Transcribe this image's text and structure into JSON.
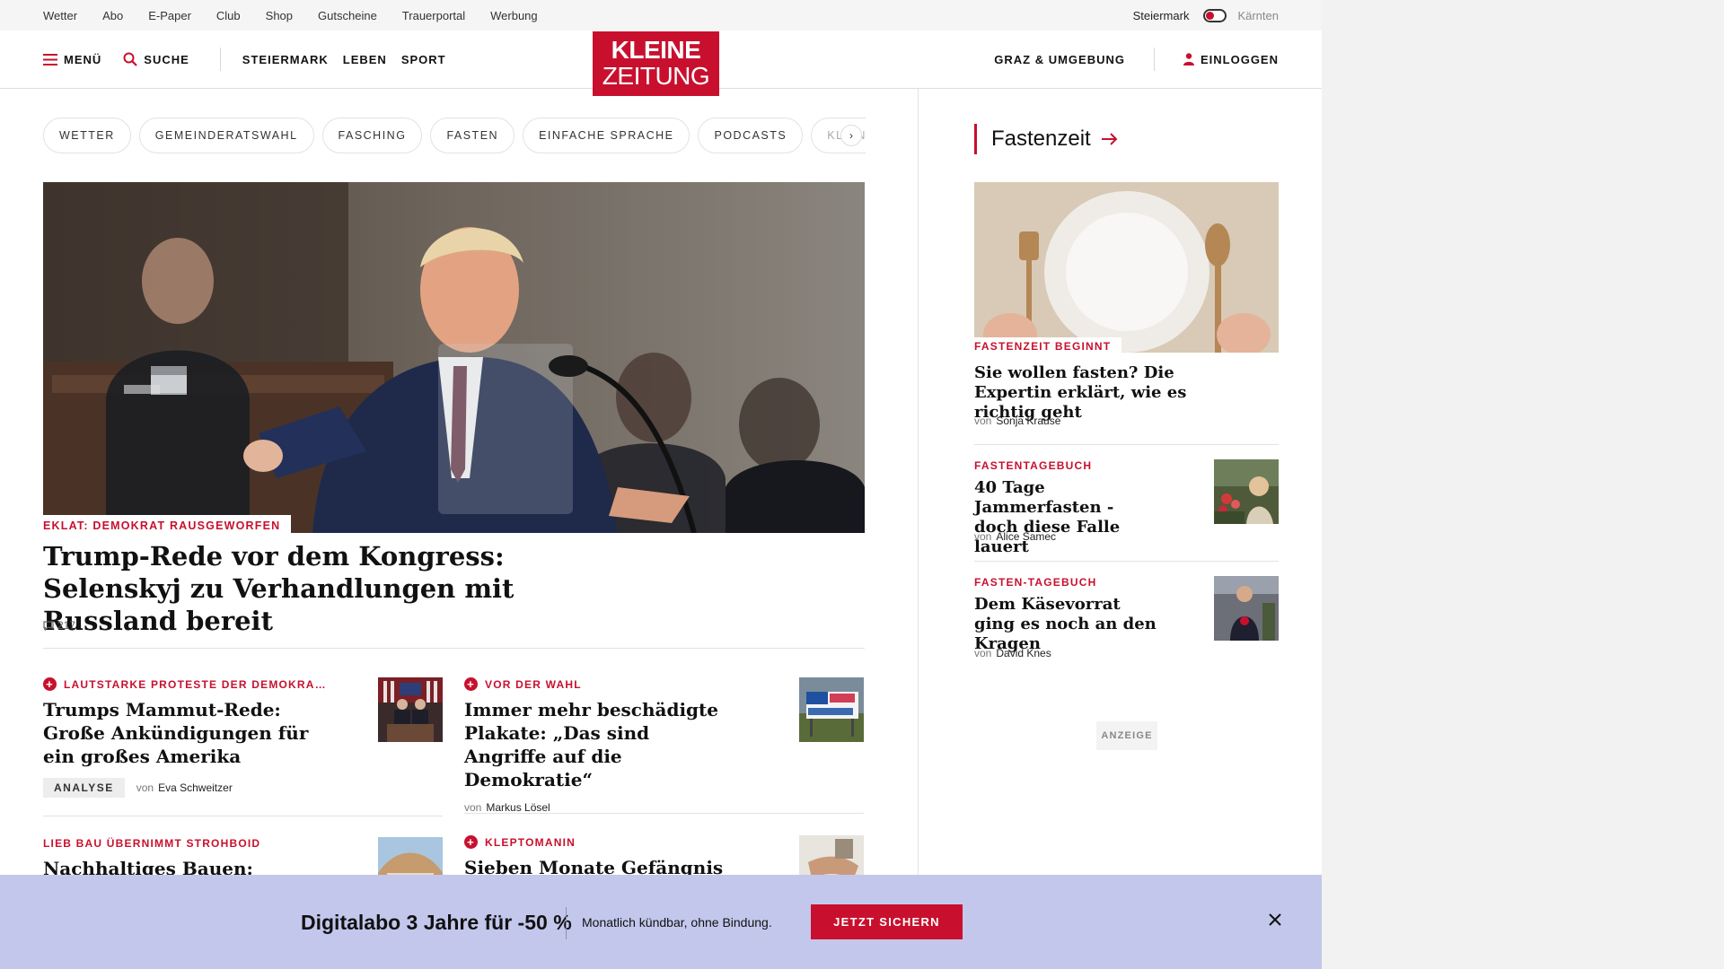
{
  "utility_bar": {
    "links": [
      "Wetter",
      "Abo",
      "E-Paper",
      "Club",
      "Shop",
      "Gutscheine",
      "Trauerportal",
      "Werbung"
    ],
    "region_active": "Steiermark",
    "region_inactive": "Kärnten"
  },
  "header": {
    "menu_label": "MENÜ",
    "search_label": "SUCHE",
    "nav": [
      "STEIERMARK",
      "LEBEN",
      "SPORT"
    ],
    "logo_line1": "KLEINE",
    "logo_line2": "ZEITUNG",
    "local_label": "GRAZ & UMGEBUNG",
    "login_label": "EINLOGGEN"
  },
  "topics": [
    "WETTER",
    "GEMEINDERATSWAHL",
    "FASCHING",
    "FASTEN",
    "EINFACHE SPRACHE",
    "PODCASTS",
    "KLEINE KIN"
  ],
  "hero": {
    "kicker": "EKLAT: DEMOKRAT RAUSGEWORFEN",
    "title": "Trump-Rede vor dem Kongress: Selenskyj zu Verhandlungen mit Russland bereit",
    "comments": "217"
  },
  "articles": [
    {
      "kicker": "LAUTSTARKE PROTESTE DER DEMOKRA…",
      "title": "Trumps Mammut-Rede: Große Ankündigungen für ein großes Amerika",
      "badge": "ANALYSE",
      "by": "von",
      "author": "Eva Schweitzer"
    },
    {
      "kicker": "VOR DER WAHL",
      "title": "Immer mehr beschädigte Plakate: „Das sind Angriffe auf die Demokratie“",
      "by": "von",
      "author": "Markus Lösel"
    },
    {
      "kicker": "LIEB BAU ÜBERNIMMT STROHBOID",
      "title": "Nachhaltiges Bauen: Weizer"
    },
    {
      "kicker": "KLEPTOMANIN",
      "title": "Sieben Monate Gefängnis"
    }
  ],
  "sidebar": {
    "section_title": "Fastenzeit",
    "lead": {
      "kicker": "FASTENZEIT BEGINNT",
      "title": "Sie wollen fasten? Die Expertin erklärt, wie es richtig geht",
      "by": "von",
      "author": "Sonja Krause"
    },
    "items": [
      {
        "kicker": "FASTENTAGEBUCH",
        "title": "40 Tage Jammerfasten - doch diese Falle lauert",
        "by": "von",
        "author": "Alice Samec"
      },
      {
        "kicker": "FASTEN-TAGEBUCH",
        "title": "Dem Käsevorrat ging es noch an den Kragen",
        "by": "von",
        "author": "David Knes"
      }
    ],
    "ad_label": "ANZEIGE"
  },
  "promo": {
    "headline": "Digitalabo 3 Jahre für -50 %",
    "subline": "Monatlich kündbar, ohne Bindung.",
    "cta": "JETZT SICHERN"
  },
  "colors": {
    "brand_red": "#c8102e",
    "promo_bg": "#c3c7ec",
    "text": "#121212"
  }
}
